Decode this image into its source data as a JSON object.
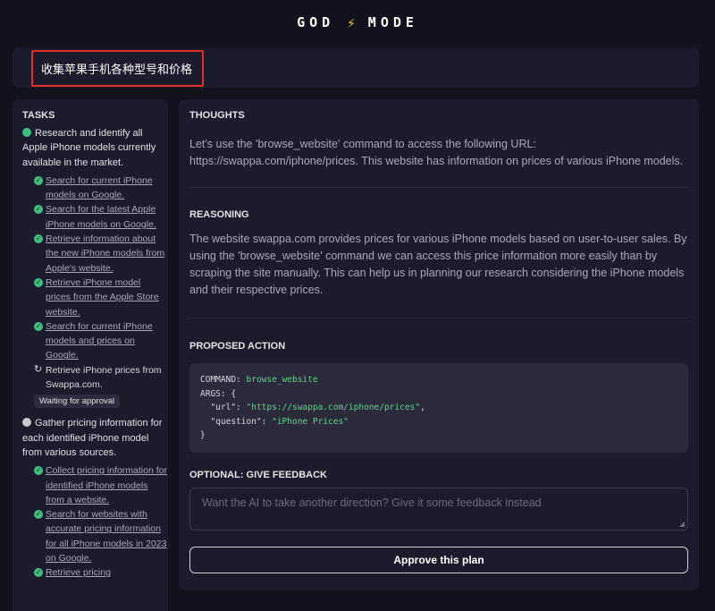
{
  "header": {
    "left": "GOD",
    "right": "MODE"
  },
  "objective": {
    "text": "收集苹果手机各种型号和价格"
  },
  "tasks": {
    "title": "TASKS",
    "items": [
      {
        "label": "Research and identify all Apple iPhone models currently available in the market.",
        "status": "done",
        "subtasks": [
          {
            "label": "Search for current iPhone models on Google.",
            "status": "done"
          },
          {
            "label": "Search for the latest Apple iPhone models on Google.",
            "status": "done"
          },
          {
            "label": "Retrieve information about the new iPhone models from Apple's website.",
            "status": "done"
          },
          {
            "label": "Retrieve iPhone model prices from the Apple Store website.",
            "status": "done"
          },
          {
            "label": "Search for current iPhone models and prices on Google.",
            "status": "done"
          },
          {
            "label": "Retrieve iPhone prices from Swappa.com.",
            "status": "in-progress"
          }
        ],
        "badge": "Waiting for approval"
      },
      {
        "label": "Gather pricing information for each identified iPhone model from various sources.",
        "status": "pending",
        "subtasks": [
          {
            "label": "Collect pricing information for identified iPhone models from a website.",
            "status": "done"
          },
          {
            "label": "Search for websites with accurate pricing information for all iPhone models in 2023 on Google.",
            "status": "done"
          },
          {
            "label": "Retrieve pricing",
            "status": "done"
          }
        ]
      }
    ]
  },
  "thoughts": {
    "title": "THOUGHTS",
    "text": "Let's use the 'browse_website' command to access the following URL: https://swappa.com/iphone/prices. This website has information on prices of various iPhone models."
  },
  "reasoning": {
    "title": "REASONING",
    "text": "The website swappa.com provides prices for various iPhone models based on user-to-user sales. By using the 'browse_website' command we can access this price information more easily than by scraping the site manually. This can help us in planning our research considering the iPhone models and their respective prices."
  },
  "action": {
    "title": "PROPOSED ACTION",
    "command_key": "COMMAND:",
    "command": "browse_website",
    "args_key": "ARGS: {",
    "url_key": "\"url\":",
    "url": "\"https://swappa.com/iphone/prices\"",
    "question_key": "\"question\":",
    "question": "\"iPhone Prices\"",
    "close": "}"
  },
  "feedback": {
    "title": "OPTIONAL: GIVE FEEDBACK",
    "placeholder": "Want the AI to take another direction? Give it some feedback instead"
  },
  "approve": {
    "label": "Approve this plan"
  },
  "colors": {
    "accent": "#3fbf7f",
    "highlight": "#e0302c",
    "bolt": "#f5c518"
  }
}
